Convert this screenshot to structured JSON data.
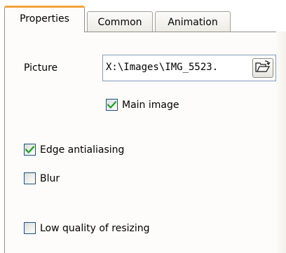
{
  "tabs": [
    {
      "label": "Properties",
      "active": true
    },
    {
      "label": "Common",
      "active": false
    },
    {
      "label": "Animation",
      "active": false
    }
  ],
  "picture": {
    "label": "Picture",
    "value": "X:\\Images\\IMG_5523.",
    "browse_icon": "open-folder-icon"
  },
  "checkboxes": {
    "main_image": {
      "label": "Main image",
      "checked": true
    },
    "edge_antialiasing": {
      "label": "Edge antialiasing",
      "checked": true
    },
    "blur": {
      "label": "Blur",
      "checked": false
    },
    "low_quality_resizing": {
      "label": "Low quality of resizing",
      "checked": false
    }
  },
  "colors": {
    "active_tab_accent": "#f1a33a",
    "checkmark": "#21a121",
    "panel_background": "#fdfcfa"
  }
}
